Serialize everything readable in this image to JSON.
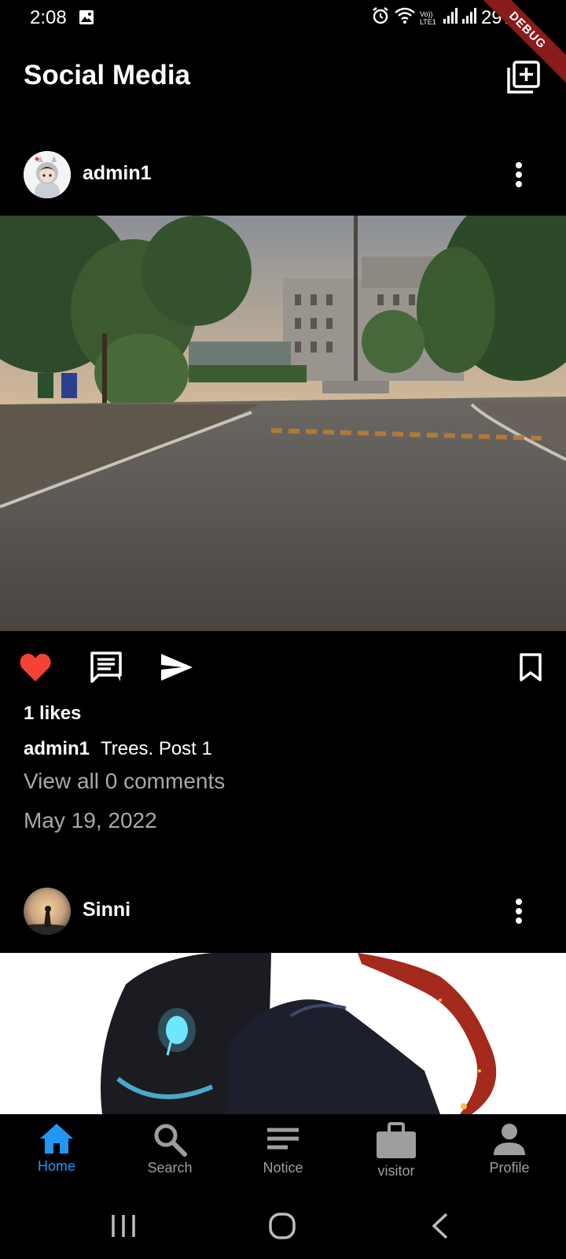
{
  "status_bar": {
    "time": "2:08",
    "battery": "29%",
    "debug_label": "DEBUG",
    "network_label": "Vo)) LTE1"
  },
  "app_bar": {
    "title": "Social Media",
    "add_icon": "add-box-icon"
  },
  "posts": [
    {
      "username": "admin1",
      "likes": "1 likes",
      "caption_user": "admin1",
      "caption": "Trees. Post 1",
      "comments_link": "View all 0 comments",
      "date": "May 19, 2022",
      "liked": true
    },
    {
      "username": "Sinni"
    }
  ],
  "bottom_nav": {
    "items": [
      {
        "label": "Home",
        "icon": "home-icon",
        "active": true
      },
      {
        "label": "Search",
        "icon": "search-icon",
        "active": false
      },
      {
        "label": "Notice",
        "icon": "notice-icon",
        "active": false
      },
      {
        "label": "visitor",
        "icon": "briefcase-icon",
        "active": false
      },
      {
        "label": "Profile",
        "icon": "person-icon",
        "active": false
      }
    ]
  },
  "colors": {
    "accent": "#2196f3",
    "like": "#f44336",
    "muted": "#a8a8a8",
    "background": "#000000"
  }
}
